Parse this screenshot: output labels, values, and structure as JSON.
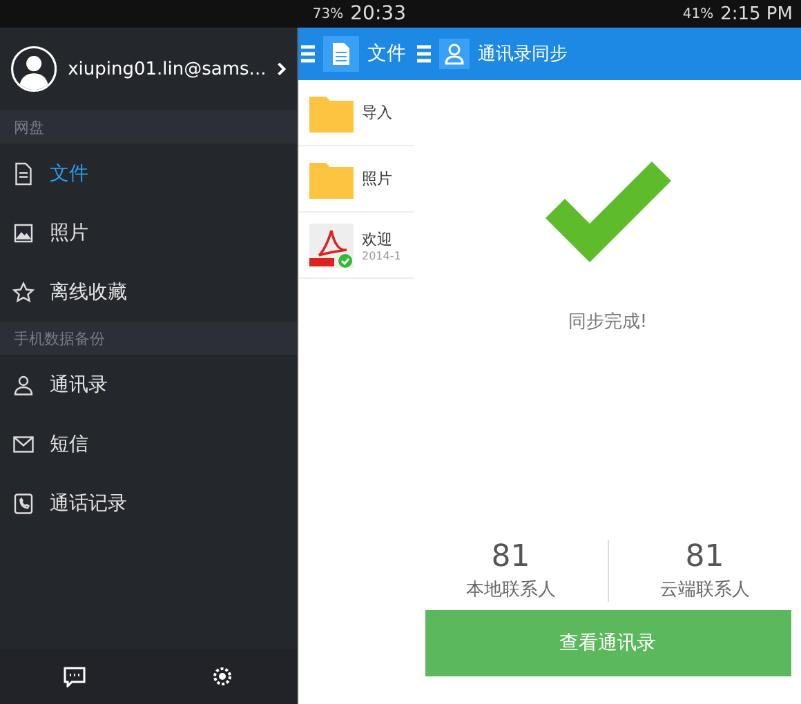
{
  "left_phone": {
    "status_bar": {
      "battery": "73%",
      "time": "20:33"
    },
    "drawer": {
      "account": "xiuping01.lin@sams...",
      "sections": [
        {
          "title": "网盘",
          "items": [
            {
              "label": "文件",
              "kind": "file",
              "selected": true
            },
            {
              "label": "照片",
              "kind": "image",
              "selected": false
            },
            {
              "label": "离线收藏",
              "kind": "star",
              "selected": false
            }
          ]
        },
        {
          "title": "手机数据备份",
          "items": [
            {
              "label": "通讯录",
              "kind": "person",
              "selected": false
            },
            {
              "label": "短信",
              "kind": "mail",
              "selected": false
            },
            {
              "label": "通话记录",
              "kind": "phone",
              "selected": false
            }
          ]
        }
      ]
    },
    "files_panel": {
      "title": "文件",
      "rows": [
        {
          "kind": "folder",
          "name": "导入"
        },
        {
          "kind": "folder",
          "name": "照片"
        },
        {
          "kind": "pdf",
          "name": "欢迎",
          "date": "2014-1"
        }
      ]
    }
  },
  "right_phone": {
    "status_bar": {
      "battery": "41%",
      "time": "2:15 PM"
    },
    "title": "通讯录同步",
    "message": "同步完成!",
    "stats": [
      {
        "value": "81",
        "label": "本地联系人"
      },
      {
        "value": "81",
        "label": "云端联系人"
      }
    ],
    "button": "查看通讯录"
  }
}
